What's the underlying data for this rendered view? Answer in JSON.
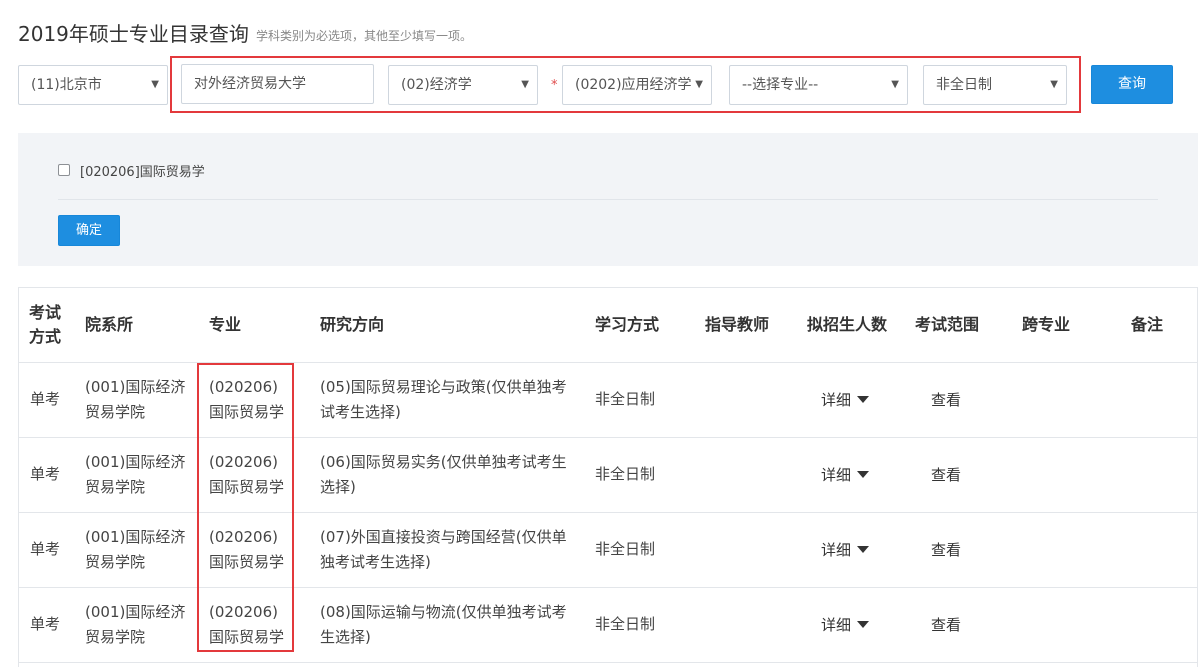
{
  "header": {
    "title": "2019年硕士专业目录查询",
    "hint": "学科类别为必选项，其他至少填写一项。"
  },
  "filters": {
    "province": "(11)北京市",
    "school": "对外经济贸易大学",
    "category": "(02)经济学",
    "required_mark": "*",
    "discipline": "(0202)应用经济学",
    "major": "--选择专业--",
    "study_mode": "非全日制",
    "query_label": "查询"
  },
  "panel": {
    "checkbox_label": "[020206]国际贸易学",
    "confirm_label": "确定"
  },
  "table": {
    "columns": [
      "考试方式",
      "院系所",
      "专业",
      "研究方向",
      "学习方式",
      "指导教师",
      "拟招生人数",
      "考试范围",
      "跨专业",
      "备注"
    ],
    "rows": [
      {
        "exam": "单考",
        "dept": "(001)国际经济贸易学院",
        "major": "(020206)国际贸易学",
        "direction": "(05)国际贸易理论与政策(仅供单独考试考生选择)",
        "mode": "非全日制",
        "advisor": "",
        "quota": "详细",
        "scope": "查看",
        "cross": "",
        "note": ""
      },
      {
        "exam": "单考",
        "dept": "(001)国际经济贸易学院",
        "major": "(020206)国际贸易学",
        "direction": "(06)国际贸易实务(仅供单独考试考生选择)",
        "mode": "非全日制",
        "advisor": "",
        "quota": "详细",
        "scope": "查看",
        "cross": "",
        "note": ""
      },
      {
        "exam": "单考",
        "dept": "(001)国际经济贸易学院",
        "major": "(020206)国际贸易学",
        "direction": "(07)外国直接投资与跨国经营(仅供单独考试考生选择)",
        "mode": "非全日制",
        "advisor": "",
        "quota": "详细",
        "scope": "查看",
        "cross": "",
        "note": ""
      },
      {
        "exam": "单考",
        "dept": "(001)国际经济贸易学院",
        "major": "(020206)国际贸易学",
        "direction": "(08)国际运输与物流(仅供单独考试考生选择)",
        "mode": "非全日制",
        "advisor": "",
        "quota": "详细",
        "scope": "查看",
        "cross": "",
        "note": ""
      }
    ]
  },
  "colors": {
    "accent": "#1e8ee0",
    "highlight_frame": "#e3393c",
    "panel_bg": "#f2f4f7"
  }
}
